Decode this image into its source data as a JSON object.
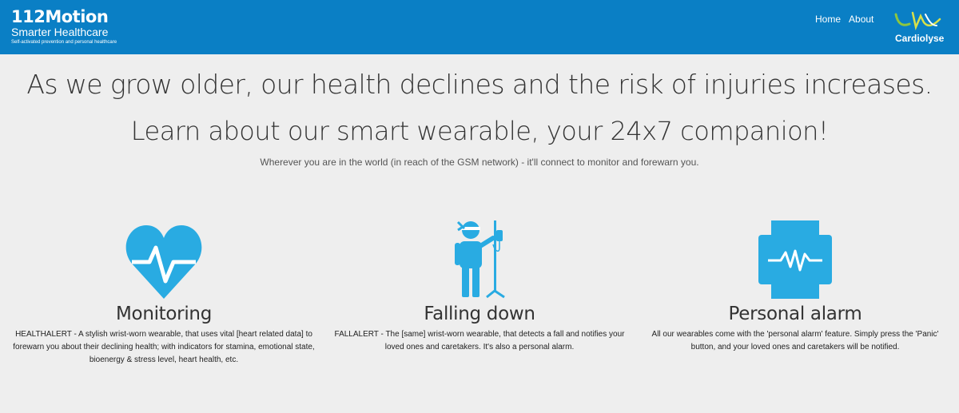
{
  "header": {
    "brand_name": "112Motion",
    "brand_subtitle": "Smarter Healthcare",
    "brand_tagline": "Self-activated prevention and personal healthcare",
    "nav": [
      "Home",
      "About"
    ],
    "partner_logo_text": "Cardiolyse",
    "colors": {
      "bar": "#0a7fc5",
      "accent_green": "#8dc63f"
    }
  },
  "hero": {
    "headline": "As we grow older, our health declines and the risk of injuries increases.",
    "subheadline": "Learn about our smart wearable, your 24x7 companion!",
    "note": "Wherever you are in the world (in reach of the GSM network) - it'll connect to monitor and forewarn you."
  },
  "features": [
    {
      "icon": "heart-pulse-icon",
      "title": "Monitoring",
      "text": "HEALTHALERT - A stylish wrist-worn wearable, that uses vital [heart related data] to forewarn you about their declining health; with indicators for stamina, emotional state, bioenergy & stress level, heart health, etc."
    },
    {
      "icon": "patient-iv-icon",
      "title": "Falling down",
      "text": "FALLALERT - The [same] wrist-worn wearable, that detects a fall and notifies your loved ones and caretakers. It's also a personal alarm."
    },
    {
      "icon": "watch-pulse-icon",
      "title": "Personal alarm",
      "text": "All our wearables come with the 'personal alarm' feature. Simply press the 'Panic' button, and your loved ones and caretakers will be notified."
    }
  ],
  "icon_color": "#29abe2"
}
